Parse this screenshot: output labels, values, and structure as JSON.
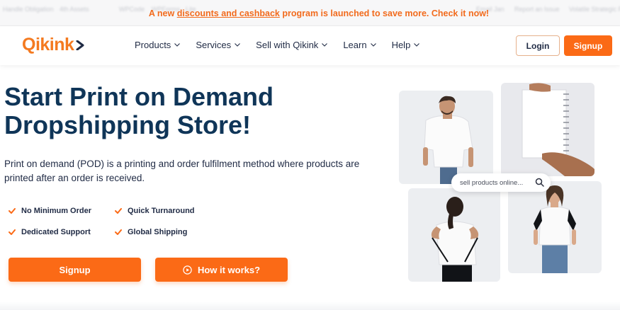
{
  "announcement": {
    "prefix": "A new ",
    "link": "discounts and cashback",
    "suffix": " program is launched to save more. Check it now!",
    "ghost_items": [
      "Handle Obligation",
      "4th Assets",
      "WPCode",
      "WPForms · Lite",
      "Email Jan",
      "Report an Issue",
      "Volatile Strategic Pr"
    ]
  },
  "nav": {
    "logo": "Qikink",
    "menu": [
      "Products",
      "Services",
      "Sell with Qikink",
      "Learn",
      "Help"
    ],
    "login": "Login",
    "signup": "Signup"
  },
  "hero": {
    "title": "Start Print on Demand Dropshipping Store!",
    "description": "Print on demand (POD) is a printing and order fulfilment method where products are printed after an order is received.",
    "features": [
      "No Minimum Order",
      "Quick Turnaround",
      "Dedicated Support",
      "Global Shipping"
    ],
    "signup_button": "Signup",
    "how_button": "How it works?"
  },
  "collage": {
    "search_text": "sell products online..."
  },
  "colors": {
    "accent": "#fb6a16",
    "heading": "#0f3558",
    "announcement": "#f26b1d"
  }
}
